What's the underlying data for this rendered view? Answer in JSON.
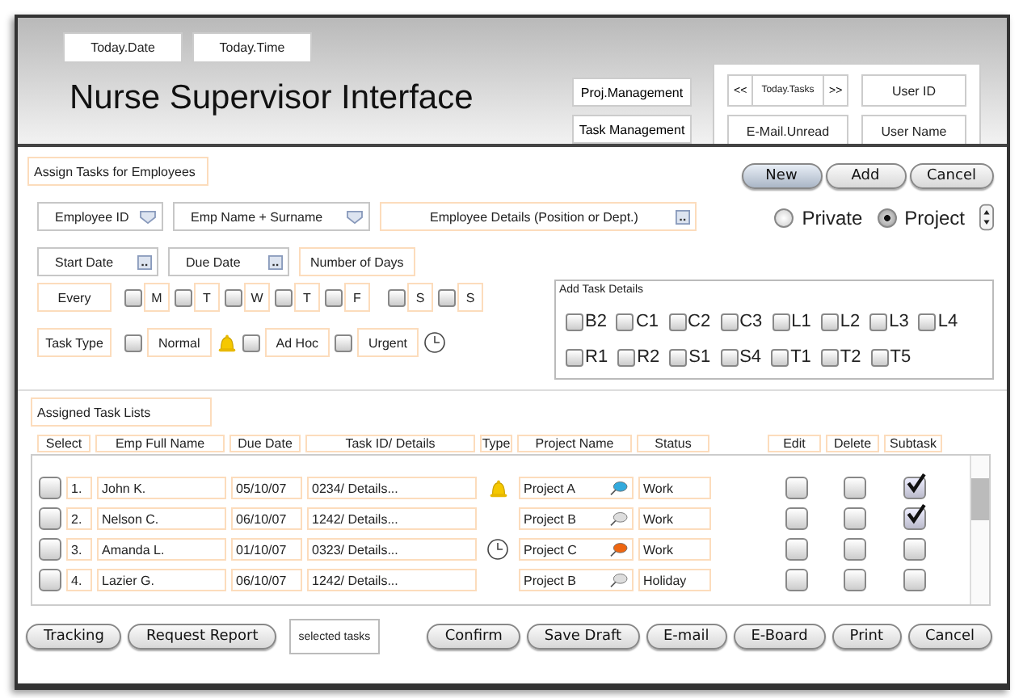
{
  "header": {
    "date": "Today.Date",
    "time": "Today.Time",
    "title": "Nurse Supervisor Interface",
    "nav": [
      "Proj.Management",
      "Task Management"
    ],
    "pager": {
      "prev": "<<",
      "label": "Today.Tasks",
      "next": ">>"
    },
    "email": "E-Mail.Unread",
    "user_id": "User ID",
    "user_name": "User Name"
  },
  "assign": {
    "title": "Assign Tasks for Employees",
    "actions": [
      {
        "label": "New",
        "selected": true
      },
      {
        "label": "Add",
        "selected": false
      },
      {
        "label": "Cancel",
        "selected": false
      }
    ],
    "radios": [
      {
        "label": "Private",
        "selected": false
      },
      {
        "label": "Project",
        "selected": true
      }
    ],
    "employee_id": "Employee ID",
    "employee_name": "Emp Name + Surname",
    "employee_details": "Employee Details (Position or Dept.)",
    "start_date": "Start Date",
    "due_date": "Due Date",
    "days": "Number of Days",
    "every": "Every",
    "weekdays": [
      {
        "label": "M",
        "checked": false
      },
      {
        "label": "T",
        "checked": false
      },
      {
        "label": "W",
        "checked": false
      },
      {
        "label": "T",
        "checked": false
      },
      {
        "label": "F",
        "checked": false
      },
      {
        "label": "S",
        "checked": false
      },
      {
        "label": "S",
        "checked": false
      }
    ],
    "task_type": "Task Type",
    "types": [
      {
        "label": "Normal",
        "checked": false,
        "kind": "plain"
      },
      {
        "label": "Ad Hoc",
        "checked": false,
        "kind": "bell"
      },
      {
        "label": "Urgent",
        "checked": false,
        "kind": "clock"
      }
    ],
    "details_title": "Add Task Details",
    "details": [
      [
        {
          "label": "B2",
          "checked": false
        },
        {
          "label": "C1",
          "checked": false
        },
        {
          "label": "C2",
          "checked": false
        },
        {
          "label": "C3",
          "checked": false
        },
        {
          "label": "L1",
          "checked": false
        },
        {
          "label": "L2",
          "checked": false
        },
        {
          "label": "L3",
          "checked": false
        },
        {
          "label": "L4",
          "checked": false
        }
      ],
      [
        {
          "label": "R1",
          "checked": false
        },
        {
          "label": "R2",
          "checked": false
        },
        {
          "label": "S1",
          "checked": false
        },
        {
          "label": "S4",
          "checked": false
        },
        {
          "label": "T1",
          "checked": false
        },
        {
          "label": "T2",
          "checked": false
        },
        {
          "label": "T5",
          "checked": false
        }
      ]
    ]
  },
  "assigned": {
    "title": "Assigned Task Lists",
    "columns": [
      "Select",
      "Emp Full Name",
      "Due Date",
      "Task ID/ Details",
      "Type",
      "Project Name",
      "Status",
      "Edit",
      "Delete",
      "Subtask"
    ],
    "rows": [
      {
        "selected": false,
        "number": "1.",
        "name": "John K.",
        "due": "05/10/07",
        "task": "0234/ Details...",
        "kind": "bell",
        "project": "Project A",
        "color": "#33aadd",
        "status": "Work",
        "edit": false,
        "delete": false,
        "subtask": true
      },
      {
        "selected": false,
        "number": "2.",
        "name": "Nelson C.",
        "due": "06/10/07",
        "task": "1242/ Details...",
        "kind": "plain",
        "project": "Project B",
        "color": "#dddddd",
        "status": "Work",
        "edit": false,
        "delete": false,
        "subtask": true
      },
      {
        "selected": false,
        "number": "3.",
        "name": "Amanda L.",
        "due": "01/10/07",
        "task": "0323/ Details...",
        "kind": "clock",
        "project": "Project C",
        "color": "#ee6611",
        "status": "Work",
        "edit": false,
        "delete": false,
        "subtask": false
      },
      {
        "selected": false,
        "number": "4.",
        "name": "Lazier G.",
        "due": "06/10/07",
        "task": "1242/ Details...",
        "kind": "plain",
        "project": "Project B",
        "color": "#dddddd",
        "status": "Holiday",
        "edit": false,
        "delete": false,
        "subtask": false
      }
    ]
  },
  "footer": {
    "left": [
      "Tracking",
      "Request Report"
    ],
    "field": "selected tasks",
    "right": [
      "Confirm",
      "Save Draft",
      "E-mail",
      "E-Board",
      "Print",
      "Cancel"
    ]
  }
}
